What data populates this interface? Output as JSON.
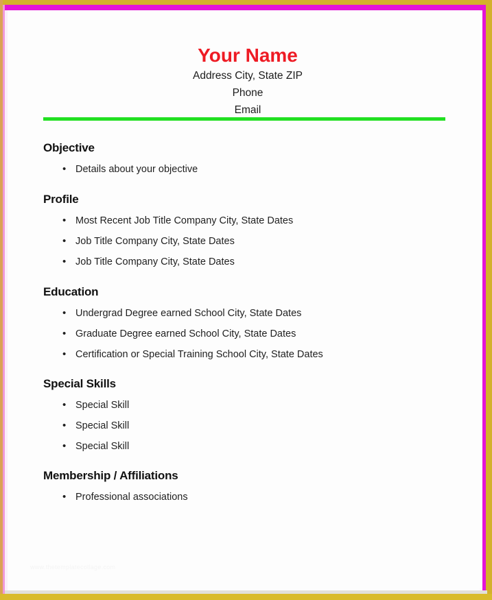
{
  "document": {
    "type": "resume-template",
    "accent_colors": {
      "name_red": "#ee1b24",
      "rule_green": "#22e022",
      "frame_magenta": "#e414d8",
      "frame_gold": "#d4b12c"
    }
  },
  "header": {
    "name": "Your Name",
    "address_line": "Address  City, State  ZIP",
    "phone_line": "Phone",
    "email_line": "Email"
  },
  "sections": [
    {
      "key": "objective",
      "title": "Objective",
      "items": [
        "Details about your objective"
      ]
    },
    {
      "key": "profile",
      "title": "Profile",
      "items": [
        "Most Recent Job Title   Company  City, State  Dates",
        "Job Title   Company  City, State  Dates",
        "Job Title   Company  City, State  Dates"
      ]
    },
    {
      "key": "education",
      "title": "Education",
      "items": [
        "Undergrad Degree earned  School  City, State  Dates",
        "Graduate Degree earned  School  City, State  Dates",
        "Certification or Special Training  School  City, State  Dates"
      ]
    },
    {
      "key": "special_skills",
      "title": "Special Skills",
      "items": [
        "Special Skill",
        "Special Skill",
        "Special Skill"
      ]
    },
    {
      "key": "membership",
      "title": "Membership / Affiliations",
      "items": [
        "Professional associations"
      ]
    }
  ],
  "watermark": {
    "text": "www.thetemplatecollage.com"
  }
}
